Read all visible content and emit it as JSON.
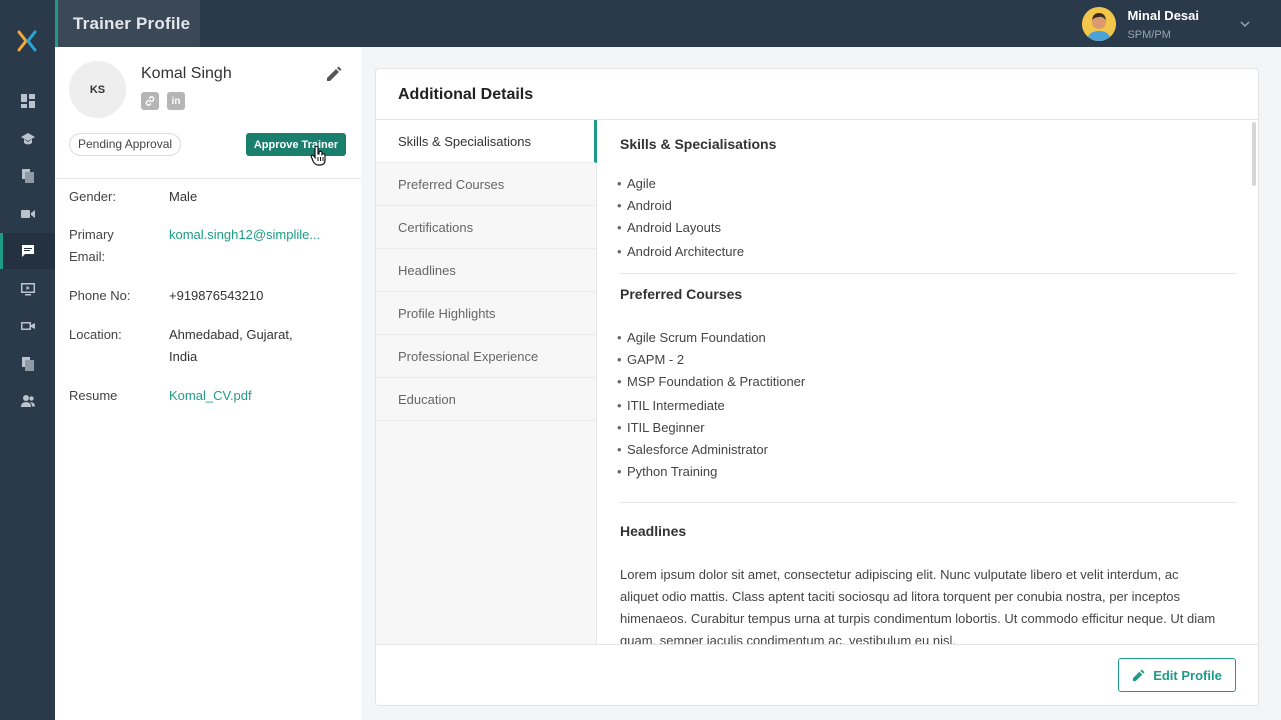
{
  "header": {
    "page_title": "Trainer Profile",
    "user_name": "Minal Desai",
    "user_role": "SPM/PM"
  },
  "sidebar": {
    "icons": [
      "dashboard-icon",
      "courses-icon",
      "documents-icon",
      "video-icon",
      "messages-icon",
      "presentation-icon",
      "recording-icon",
      "files-icon",
      "users-icon"
    ],
    "active_index": 4
  },
  "profile": {
    "initials": "KS",
    "name": "Komal Singh",
    "status": "Pending Approval",
    "approve_label": "Approve Trainer",
    "fields": [
      {
        "label": "Gender:",
        "value": "Male"
      },
      {
        "label": "Primary Email:",
        "value": "komal.singh12@simplile..."
      },
      {
        "label": "Phone No:",
        "value": "+919876543210"
      },
      {
        "label": "Location:",
        "value": "Ahmedabad, Gujarat, India"
      },
      {
        "label": "Resume",
        "value": "Komal_CV.pdf"
      }
    ]
  },
  "details": {
    "title": "Additional Details",
    "tabs": [
      "Skills & Specialisations",
      "Preferred Courses",
      "Certifications",
      "Headlines",
      "Profile Highlights",
      "Professional Experience",
      "Education"
    ],
    "active_tab": 0,
    "skills_title": "Skills & Specialisations",
    "skills": [
      "Agile",
      "Android",
      "Android Layouts",
      "Android Architecture"
    ],
    "courses_title": "Preferred Courses",
    "courses": [
      "Agile Scrum Foundation",
      "GAPM - 2",
      "MSP Foundation & Practitioner",
      "ITIL Intermediate",
      "ITIL Beginner",
      "Salesforce Administrator",
      "Python Training"
    ],
    "headlines_title": "Headlines",
    "headlines_text": "Lorem ipsum dolor sit amet, consectetur adipiscing elit. Nunc vulputate libero et velit interdum, ac aliquet odio mattis. Class aptent taciti sociosqu ad litora torquent per conubia nostra, per inceptos himenaeos. Curabitur tempus urna at turpis condimentum lobortis. Ut commodo efficitur neque. Ut diam quam, semper iaculis condimentum ac, vestibulum eu nisl.",
    "edit_label": "Edit Profile"
  }
}
